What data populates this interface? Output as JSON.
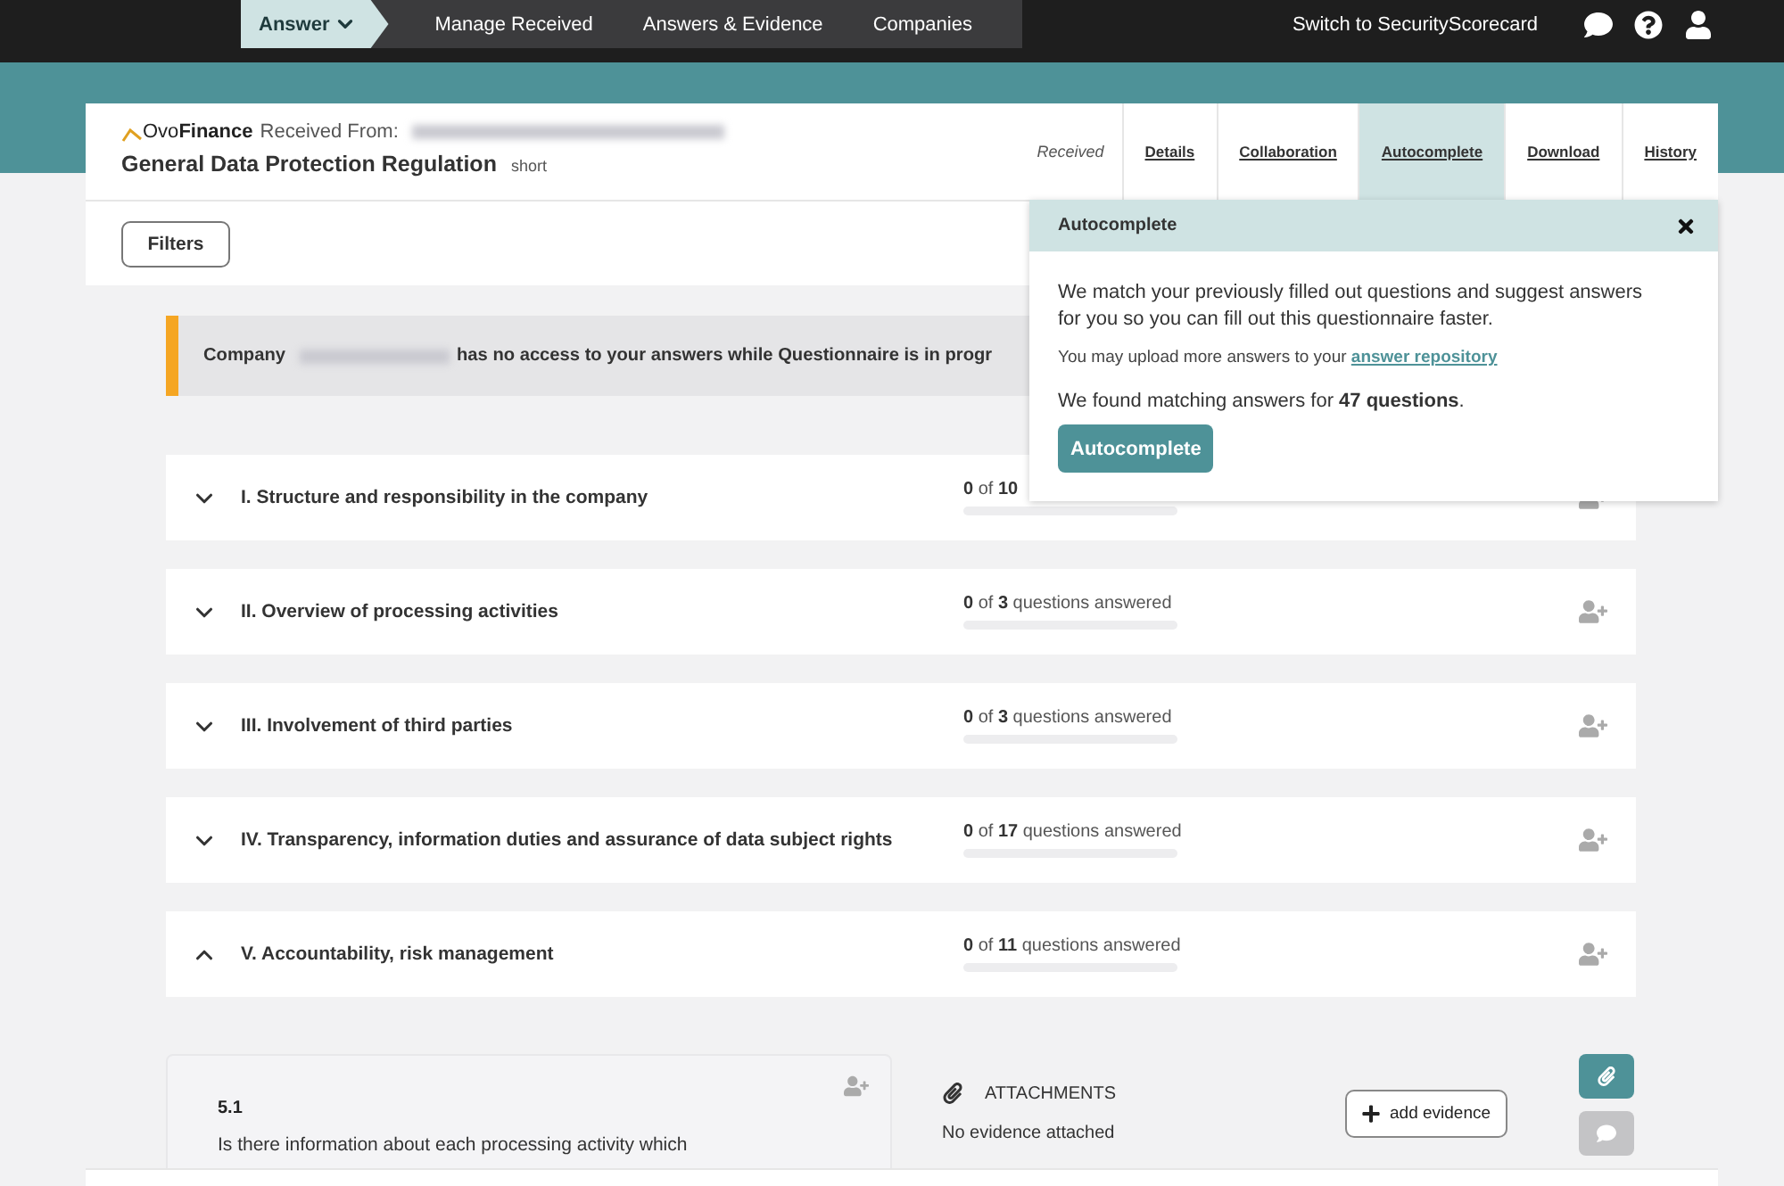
{
  "nav": {
    "tabs": [
      {
        "label": "Answer",
        "selected": true,
        "dropdown": true
      },
      {
        "label": "Manage Received",
        "selected": false,
        "dropdown": false
      },
      {
        "label": "Answers & Evidence",
        "selected": false,
        "dropdown": false
      },
      {
        "label": "Companies",
        "selected": false,
        "dropdown": false
      }
    ],
    "switch_link": "Switch to SecurityScorecard"
  },
  "header": {
    "logo": "Ovo**Finance**",
    "received_from": "Received From:",
    "title": "General Data Protection Regulation",
    "tag": "short",
    "status": "Received",
    "tabs": [
      {
        "label": "Details",
        "selected": false
      },
      {
        "label": "Collaboration",
        "selected": false
      },
      {
        "label": "Autocomplete",
        "selected": true
      },
      {
        "label": "Download",
        "selected": false
      },
      {
        "label": "History",
        "selected": false
      }
    ]
  },
  "filters_button": "Filters",
  "notice": {
    "before": "Company",
    "after": "has no access to your answers while Questionnaire is in progr"
  },
  "sections": [
    {
      "title": "I. Structure and responsibility in the company",
      "expanded": false,
      "progress": "**0** of **10**",
      "level": 0
    },
    {
      "title": "II. Overview of processing activities",
      "expanded": false,
      "progress": "**0** of **3** questions answered",
      "level": 0
    },
    {
      "title": "III. Involvement of third parties",
      "expanded": false,
      "progress": "**0** of **3** questions answered",
      "level": 0
    },
    {
      "title": "IV. Transparency, information duties and assurance of data subject rights",
      "expanded": false,
      "progress": "**0** of **17** questions answered",
      "level": 0
    },
    {
      "title": "V. Accountability, risk management",
      "expanded": true,
      "progress": "**0** of **11** questions answered",
      "level": 0
    }
  ],
  "question": {
    "number": "5.1",
    "text": "Is there information about each processing activity which"
  },
  "attachments": {
    "title": "ATTACHMENTS",
    "empty": "No evidence attached",
    "add_button": "add evidence"
  },
  "popover": {
    "title": "Autocomplete",
    "body": "We match your previously filled out questions and suggest answers for you so you can fill out this questionnaire faster.",
    "hint": "You may upload more answers to your",
    "link": "answer repository",
    "found": "We found matching answers for **47 questions**.",
    "button": "Autocomplete"
  }
}
